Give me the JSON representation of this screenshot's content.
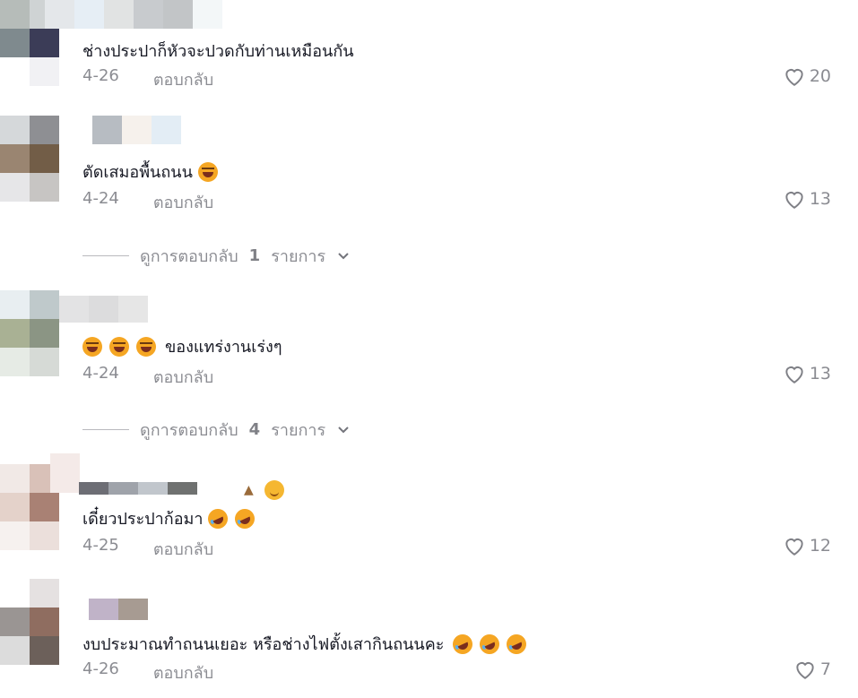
{
  "comments": [
    {
      "text": "ช่างประปาก็หัวจะปวดกับท่านเหมือนกัน",
      "date": "4-26",
      "reply_label": "ตอบกลับ",
      "likes": "20",
      "emojis": []
    },
    {
      "text": "ตัดเสมอพื้นถนน",
      "date": "4-24",
      "reply_label": "ตอบกลับ",
      "likes": "13",
      "emojis": [
        "laugh"
      ],
      "view_replies": {
        "prefix": "ดูการตอบกลับ",
        "count": "1",
        "suffix": "รายการ"
      }
    },
    {
      "text": "ของแทร่งานเร่งๆ",
      "date": "4-24",
      "reply_label": "ตอบกลับ",
      "likes": "13",
      "emojis_before": [
        "laugh",
        "laugh",
        "laugh"
      ],
      "view_replies": {
        "prefix": "ดูการตอบกลับ",
        "count": "4",
        "suffix": "รายการ"
      }
    },
    {
      "text": "เดี๋ยวประปาก้อมา",
      "date": "4-25",
      "reply_label": "ตอบกลับ",
      "likes": "12",
      "emojis": [
        "rofl",
        "rofl"
      ],
      "name_emojis": [
        "elephant-icon",
        "smile"
      ]
    },
    {
      "text": "งบประมาณทำถนนเยอะ หรือช่างไฟตั้งเสากินถนนคะ",
      "date": "4-26",
      "reply_label": "ตอบกลับ",
      "likes": "7",
      "emojis": [
        "rofl",
        "rofl",
        "rofl"
      ]
    }
  ],
  "colors": {
    "text": "#161823",
    "muted": "rgba(22,24,35,0.5)"
  }
}
